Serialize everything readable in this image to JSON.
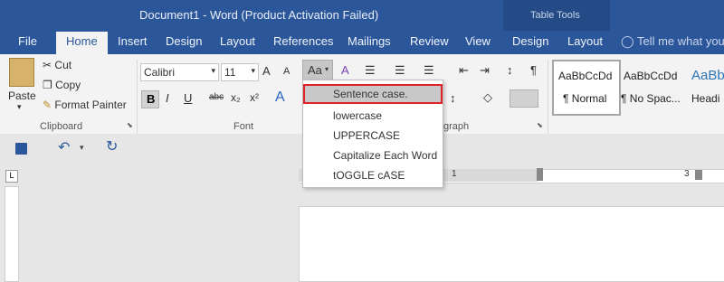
{
  "title_bar": {
    "title": "Document1 - Word (Product Activation Failed)",
    "context_group": "Table Tools"
  },
  "tabs": [
    "File",
    "Home",
    "Insert",
    "Design",
    "Layout",
    "References",
    "Mailings",
    "Review",
    "View",
    "Design",
    "Layout"
  ],
  "tell_me": "Tell me what you",
  "clipboard": {
    "paste": "Paste",
    "cut": "Cut",
    "copy": "Copy",
    "format_painter": "Format Painter",
    "group": "Clipboard"
  },
  "font": {
    "name": "Calibri",
    "size": "11",
    "case_button": "Aa",
    "bold": "B",
    "italic": "I",
    "underline": "U",
    "strike": "abc",
    "subscript": "x₂",
    "superscript": "x²",
    "text_effects": "A",
    "grow": "A",
    "shrink": "A",
    "group": "Font"
  },
  "paragraph": {
    "group": "graph"
  },
  "styles": [
    {
      "preview": "AaBbCcDd",
      "name": "¶ Normal"
    },
    {
      "preview": "AaBbCcDd",
      "name": "¶ No Spac..."
    },
    {
      "preview": "AaBbC",
      "name": "Headi"
    }
  ],
  "change_case_menu": {
    "items": [
      "Sentence case.",
      "lowercase",
      "UPPERCASE",
      "Capitalize Each Word",
      "tOGGLE cASE"
    ],
    "selected_index": 0
  },
  "ruler": {
    "marks": [
      "1",
      "3"
    ]
  },
  "colors": {
    "title_bar": "#2b579a",
    "ribbon": "#f3f3f3",
    "highlight_border": "#e0202b"
  }
}
